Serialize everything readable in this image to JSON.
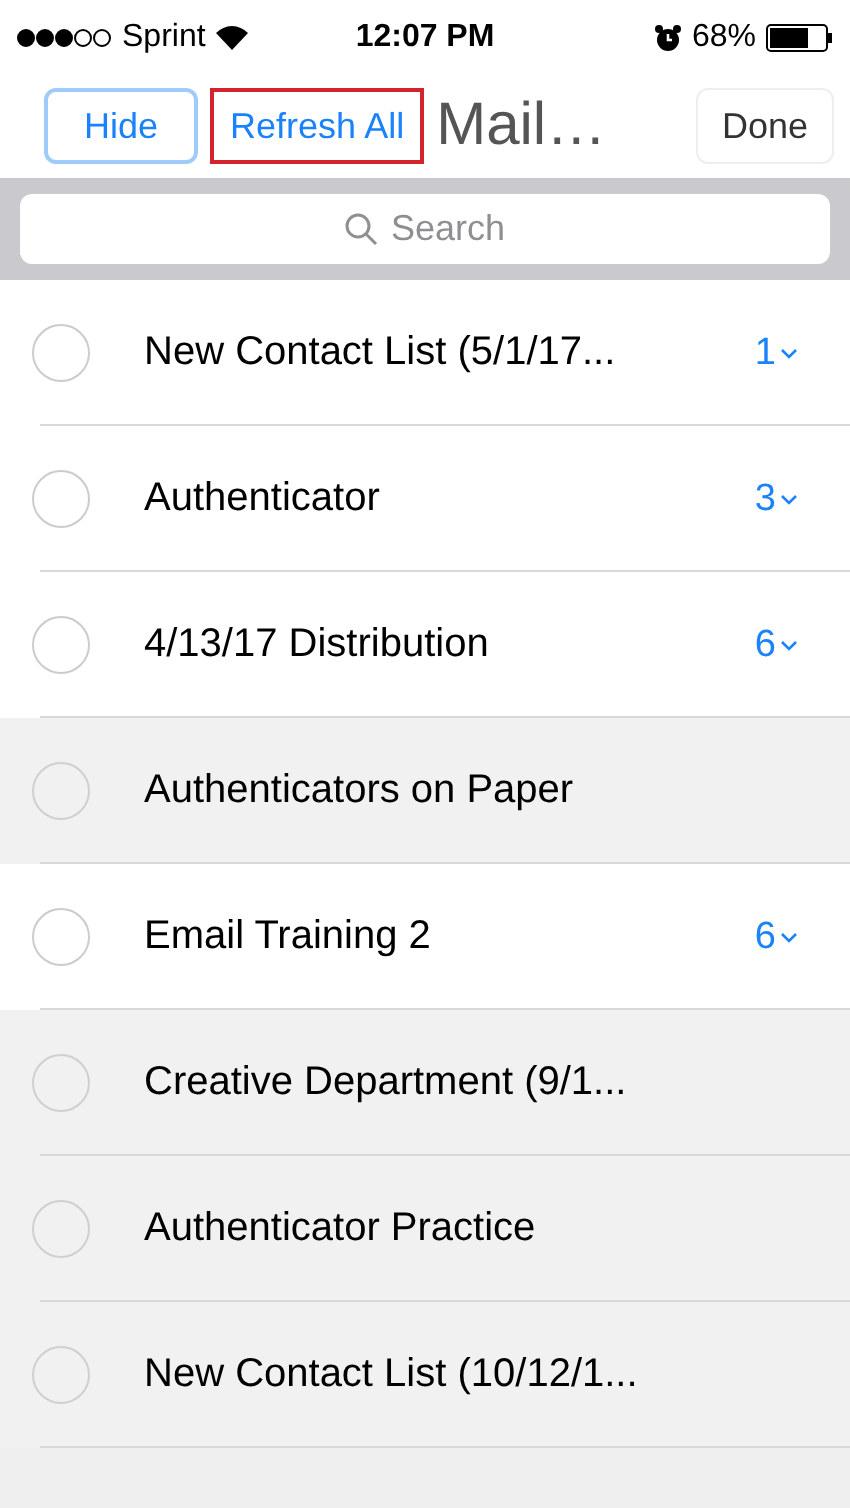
{
  "status_bar": {
    "carrier": "Sprint",
    "time": "12:07 PM",
    "battery": "68%"
  },
  "nav": {
    "buttons": [
      {
        "label": "Hide",
        "kind": "outlined",
        "highlighted": false
      },
      {
        "label": "Refresh All",
        "kind": "plain",
        "highlighted": true
      }
    ],
    "title": "Mail…",
    "done": "Done"
  },
  "search": {
    "placeholder": "Search"
  },
  "lists": [
    {
      "name": "New Contact List (5/1/17...",
      "count": "1",
      "disabled": false
    },
    {
      "name": "Authenticator",
      "count": "3",
      "disabled": false
    },
    {
      "name": "4/13/17 Distribution",
      "count": "6",
      "disabled": false
    },
    {
      "name": "Authenticators on Paper",
      "disabled": true
    },
    {
      "name": "Email Training 2",
      "count": "6",
      "disabled": false
    },
    {
      "name": "Creative Department (9/1...",
      "disabled": true
    },
    {
      "name": "Authenticator Practice",
      "disabled": true
    },
    {
      "name": "New Contact List (10/12/1...",
      "disabled": true
    }
  ]
}
